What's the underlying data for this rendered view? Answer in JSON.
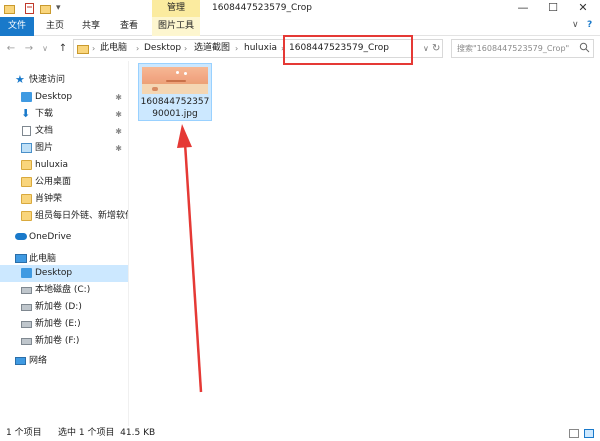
{
  "titlebar": {
    "title": "1608447523579_Crop",
    "context_tab": "管理",
    "minimize": "—",
    "maximize": "☐",
    "close": "✕"
  },
  "ribbon": {
    "tabs": [
      "文件",
      "主页",
      "共享",
      "查看",
      "图片工具"
    ],
    "collapse": "∨",
    "help": "?"
  },
  "address": {
    "breadcrumbs": [
      "此电脑",
      "Desktop",
      "选道截图",
      "huluxia",
      "1608447523579_Crop"
    ],
    "dropdown": "∨",
    "refresh": "↻"
  },
  "search": {
    "placeholder": "搜索\"1608447523579_Crop\""
  },
  "nav": {
    "quick_access": "快速访问",
    "items": [
      {
        "label": "Desktop",
        "pinned": true
      },
      {
        "label": "下载",
        "pinned": true
      },
      {
        "label": "文档",
        "pinned": true
      },
      {
        "label": "图片",
        "pinned": true
      },
      {
        "label": "huluxia"
      },
      {
        "label": "公用桌面"
      },
      {
        "label": "肖钟荣"
      },
      {
        "label": "组员每日外链、新增软件统计"
      }
    ],
    "onedrive": "OneDrive",
    "this_pc": "此电脑",
    "pc_items": [
      "Desktop",
      "本地磁盘 (C:)",
      "新加卷 (D:)",
      "新加卷 (E:)",
      "新加卷 (F:)"
    ],
    "network": "网络",
    "pin_glyph": "📌"
  },
  "content": {
    "file_name": "16084475235790001.jpg"
  },
  "status": {
    "item_count": "1 个项目",
    "selected": "选中 1 个项目  41.5 KB"
  },
  "colors": {
    "accent": "#1979ca",
    "selection": "#cce8ff",
    "annotation": "#e53935"
  }
}
